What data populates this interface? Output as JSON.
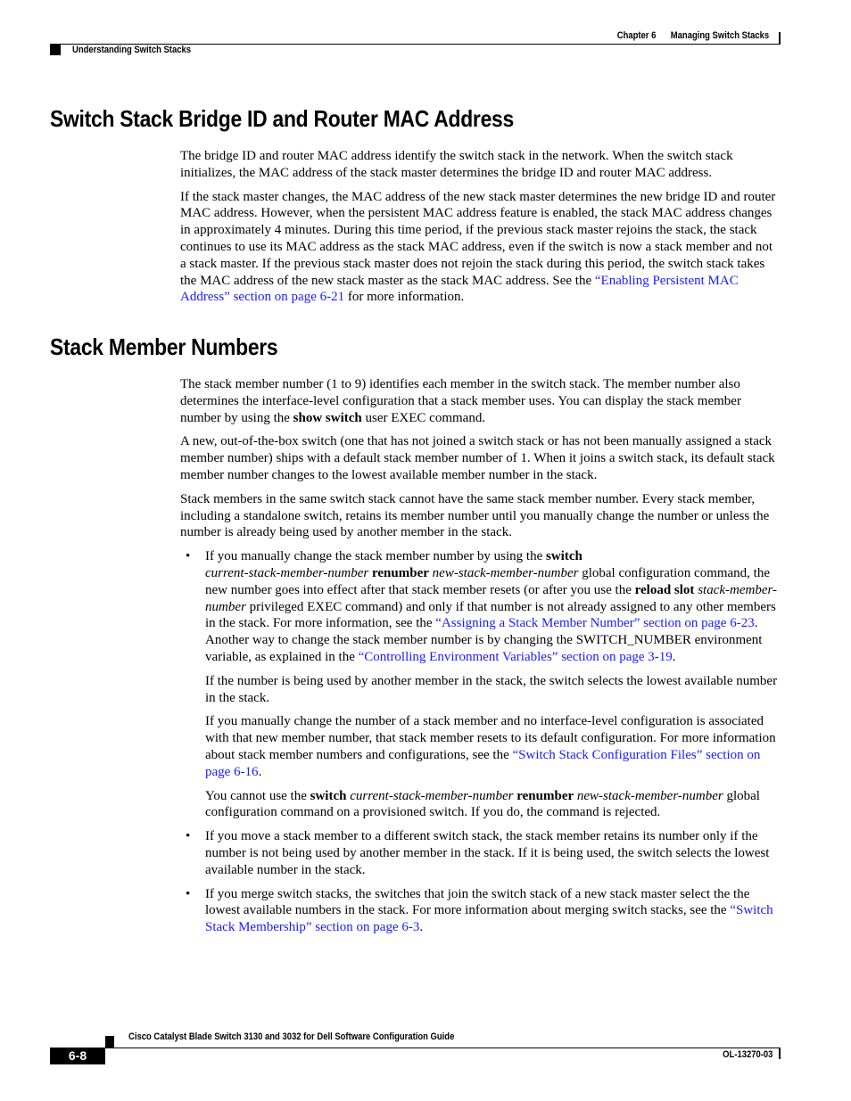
{
  "header": {
    "chapter": "Chapter 6",
    "chapter_title": "Managing Switch Stacks",
    "section": "Understanding Switch Stacks"
  },
  "section1": {
    "title": "Switch Stack Bridge ID and Router MAC Address",
    "p1": "The bridge ID and router MAC address identify the switch stack in the network. When the switch stack initializes, the MAC address of the stack master determines the bridge ID and router MAC address.",
    "p2_before": "If the stack master changes, the MAC address of the new stack master determines the new bridge ID and router MAC address. However, when the persistent MAC address feature is enabled, the stack MAC address changes in approximately 4 minutes. During this time period, if the previous stack master rejoins the stack, the stack continues to use its MAC address as the stack MAC address, even if the switch is now a stack member and not a stack master. If the previous stack master does not rejoin the stack during this period, the switch stack takes the MAC address of the new stack master as the stack MAC address. See the ",
    "p2_link": "“Enabling Persistent MAC Address” section on page 6-21",
    "p2_after": " for more information."
  },
  "section2": {
    "title": "Stack Member Numbers",
    "p1_before": "The stack member number (1 to 9) identifies each member in the switch stack. The member number also determines the interface-level configuration that a stack member uses. You can display the stack member number by using the ",
    "p1_bold": "show switch",
    "p1_after": " user EXEC command.",
    "p2": "A new, out-of-the-box switch (one that has not joined a switch stack or has not been manually assigned a stack member number) ships with a default stack member number of 1. When it joins a switch stack, its default stack member number changes to the lowest available member number in the stack.",
    "p3": "Stack members in the same switch stack cannot have the same stack member number. Every stack member, including a standalone switch, retains its member number until you manually change the number or unless the number is already being used by another member in the stack.",
    "bullet1": {
      "t1": "If you manually change the stack member number by using the ",
      "b1": "switch",
      "i1": "current-stack-member-number",
      "b2": "renumber",
      "i2": "new-stack-member-number",
      "t2": " global configuration command, the new number goes into effect after that stack member resets (or after you use the ",
      "b3": "reload slot",
      "i3": "stack-member-number",
      "t3": " privileged EXEC command) and only if that number is not already assigned to any other members in the stack. For more information, see the ",
      "link1": "“Assigning a Stack Member Number” section on page 6-23",
      "t4": ". Another way to change the stack member number is by changing the SWITCH_NUMBER environment variable, as explained in the ",
      "link2": "“Controlling Environment Variables” section on page 3-19",
      "t5": ".",
      "sub1": "If the number is being used by another member in the stack, the switch selects the lowest available number in the stack.",
      "sub2_before": "If you manually change the number of a stack member and no interface-level configuration is associated with that new member number, that stack member resets to its default configuration. For more information about stack member numbers and configurations, see the ",
      "sub2_link": "“Switch Stack Configuration Files” section on page 6-16",
      "sub2_after": ".",
      "sub3_t1": "You cannot use the ",
      "sub3_b1": "switch",
      "sub3_i1": "current-stack-member-number",
      "sub3_b2": "renumber",
      "sub3_i2": "new-stack-member-number",
      "sub3_t2": " global configuration command on a provisioned switch. If you do, the command is rejected."
    },
    "bullet2": "If you move a stack member to a different switch stack, the stack member retains its number only if the number is not being used by another member in the stack. If it is being used, the switch selects the lowest available number in the stack.",
    "bullet3": {
      "before": "If you merge switch stacks, the switches that join the switch stack of a new stack master select the the lowest available numbers in the stack. For more information about merging switch stacks, see the ",
      "link": "“Switch Stack Membership” section on page 6-3",
      "after": "."
    }
  },
  "footer": {
    "guide_title": "Cisco Catalyst Blade Switch 3130 and 3032 for Dell Software Configuration Guide",
    "page_number": "6-8",
    "doc_number": "OL-13270-03"
  },
  "colors": {
    "link": "#1a1aff",
    "text": "#000000"
  }
}
